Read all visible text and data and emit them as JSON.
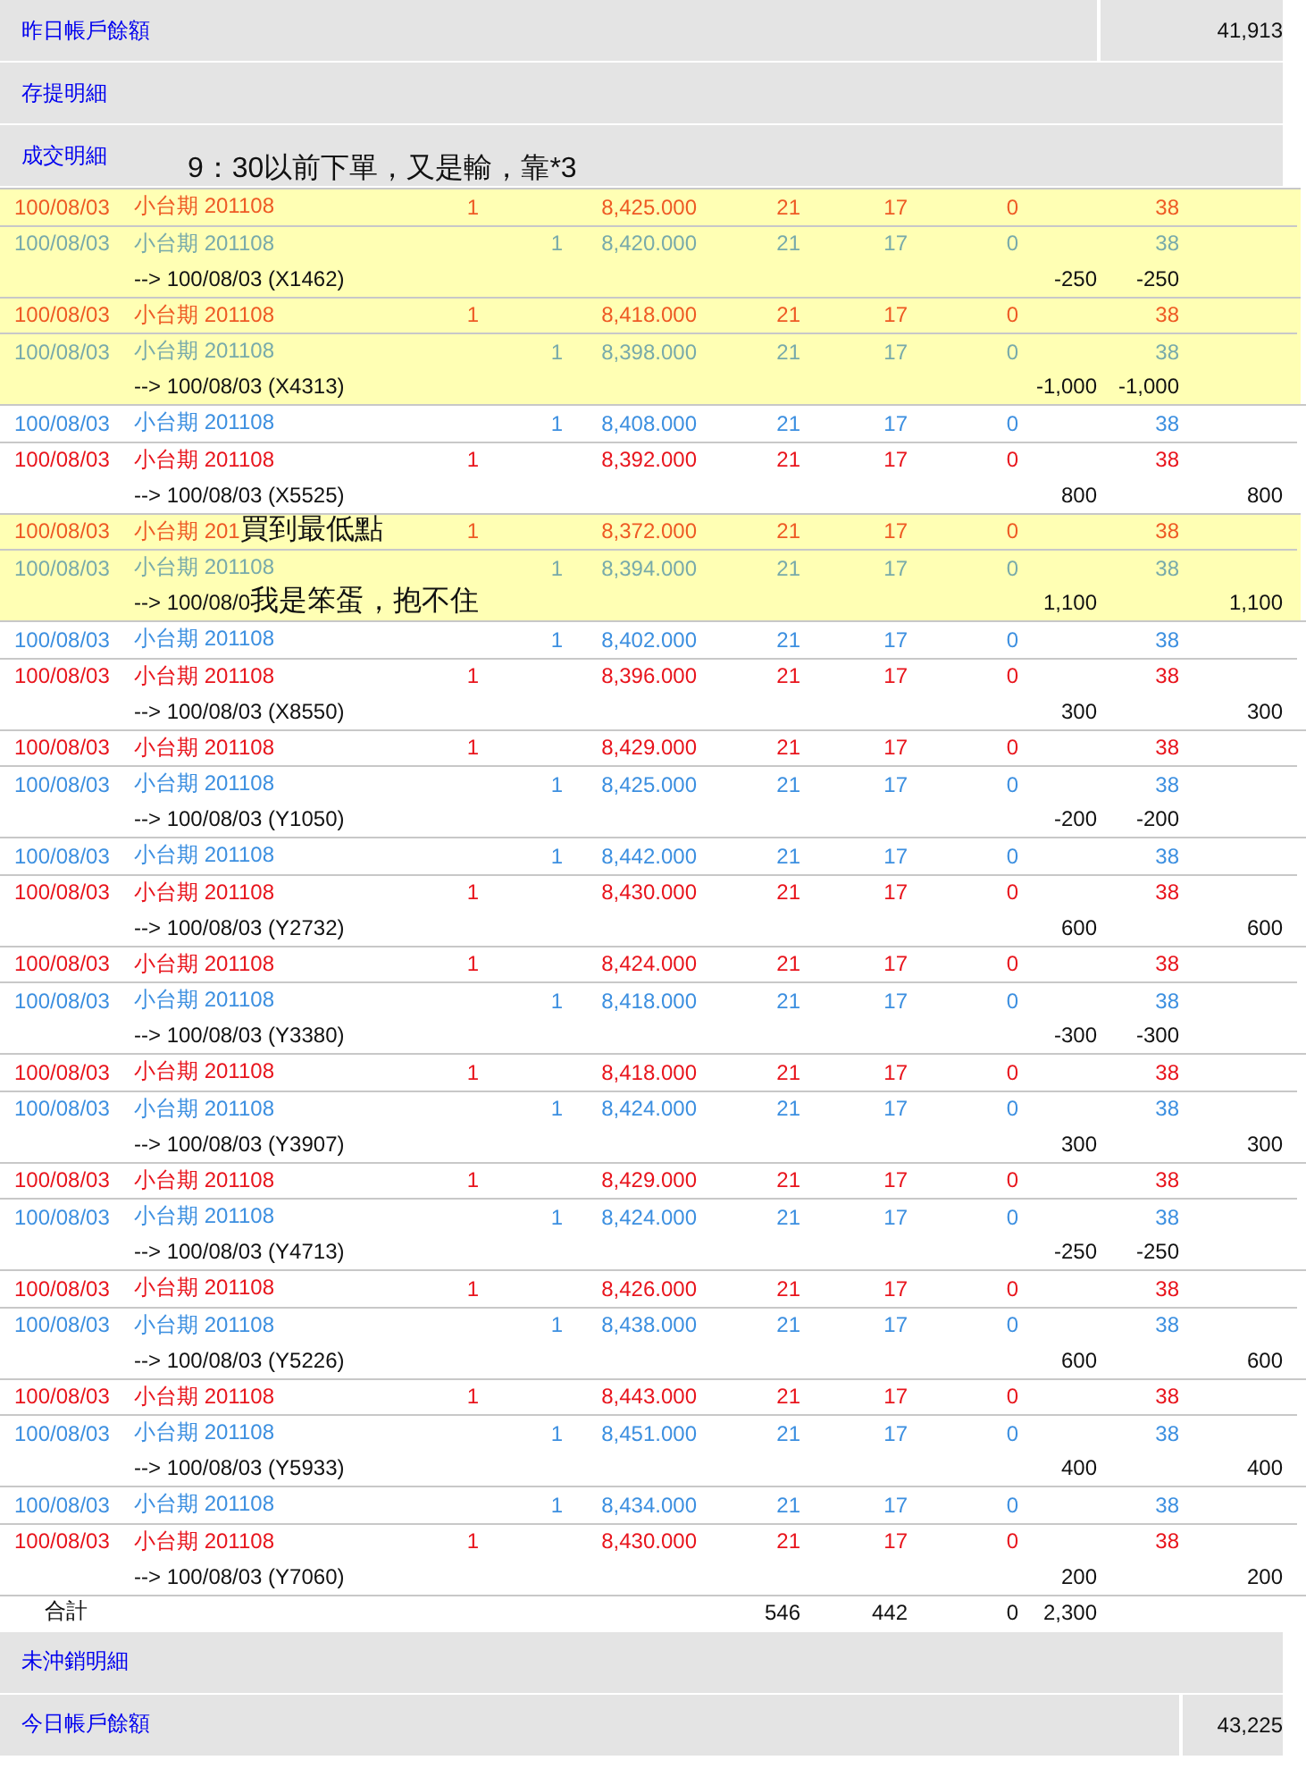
{
  "top_sections": [
    {
      "label": "昨日帳戶餘額",
      "value": "41,913"
    },
    {
      "label": "存提明細"
    },
    {
      "label": "成交明細",
      "note": "9：30以前下單，又是輸，靠*3"
    }
  ],
  "groups": [
    {
      "highlighted": true,
      "rows": [
        {
          "kind": "buy",
          "date": "100/08/03",
          "product": "小台期 201108",
          "qty": "1",
          "price": "8,425.000",
          "column_6": "21",
          "column_7": "17",
          "column_8": "0",
          "column_10": "38"
        },
        {
          "kind": "sell",
          "date": "100/08/03",
          "product": "小台期 201108",
          "qty": "1",
          "price": "8,420.000",
          "column_6": "21",
          "column_7": "17",
          "column_8": "0",
          "column_10": "38"
        }
      ],
      "close": {
        "text": "--> 100/08/03 (X1462)",
        "column_9": "-250",
        "column_10": "-250"
      }
    },
    {
      "highlighted": true,
      "rows": [
        {
          "kind": "buy",
          "date": "100/08/03",
          "product": "小台期 201108",
          "qty": "1",
          "price": "8,418.000",
          "column_6": "21",
          "column_7": "17",
          "column_8": "0",
          "column_10": "38"
        },
        {
          "kind": "sell",
          "date": "100/08/03",
          "product": "小台期 201108",
          "qty": "1",
          "price": "8,398.000",
          "column_6": "21",
          "column_7": "17",
          "column_8": "0",
          "column_10": "38"
        }
      ],
      "close": {
        "text": "--> 100/08/03 (X4313)",
        "column_9": "-1,000",
        "column_10": "-1,000"
      }
    },
    {
      "highlighted": false,
      "rows": [
        {
          "kind": "sell",
          "date": "100/08/03",
          "product": "小台期 201108",
          "qty": "1",
          "price": "8,408.000",
          "column_6": "21",
          "column_7": "17",
          "column_8": "0",
          "column_10": "38"
        },
        {
          "kind": "buy",
          "date": "100/08/03",
          "product": "小台期 201108",
          "qty": "1",
          "price": "8,392.000",
          "column_6": "21",
          "column_7": "17",
          "column_8": "0",
          "column_10": "38"
        }
      ],
      "close": {
        "text": "--> 100/08/03 (X5525)",
        "column_9": "800",
        "column_11": "800"
      }
    },
    {
      "highlighted": true,
      "rows": [
        {
          "kind": "buy",
          "date": "100/08/03",
          "product": "小台期 201",
          "note": "買到最低點",
          "qty": "1",
          "price": "8,372.000",
          "column_6": "21",
          "column_7": "17",
          "column_8": "0",
          "column_10": "38"
        },
        {
          "kind": "sell",
          "date": "100/08/03",
          "product": "小台期 201108",
          "qty": "1",
          "price": "8,394.000",
          "column_6": "21",
          "column_7": "17",
          "column_8": "0",
          "column_10": "38"
        }
      ],
      "close": {
        "text": "--> 100/08/0",
        "note": "我是笨蛋，抱不住",
        "column_9": "1,100",
        "column_11": "1,100"
      }
    },
    {
      "highlighted": false,
      "rows": [
        {
          "kind": "sell",
          "date": "100/08/03",
          "product": "小台期 201108",
          "qty": "1",
          "price": "8,402.000",
          "column_6": "21",
          "column_7": "17",
          "column_8": "0",
          "column_10": "38"
        },
        {
          "kind": "buy",
          "date": "100/08/03",
          "product": "小台期 201108",
          "qty": "1",
          "price": "8,396.000",
          "column_6": "21",
          "column_7": "17",
          "column_8": "0",
          "column_10": "38"
        }
      ],
      "close": {
        "text": "--> 100/08/03 (X8550)",
        "column_9": "300",
        "column_11": "300"
      }
    },
    {
      "highlighted": false,
      "rows": [
        {
          "kind": "buy",
          "date": "100/08/03",
          "product": "小台期 201108",
          "qty": "1",
          "price": "8,429.000",
          "column_6": "21",
          "column_7": "17",
          "column_8": "0",
          "column_10": "38"
        },
        {
          "kind": "sell",
          "date": "100/08/03",
          "product": "小台期 201108",
          "qty": "1",
          "price": "8,425.000",
          "column_6": "21",
          "column_7": "17",
          "column_8": "0",
          "column_10": "38"
        }
      ],
      "close": {
        "text": "--> 100/08/03 (Y1050)",
        "column_9": "-200",
        "column_10": "-200"
      }
    },
    {
      "highlighted": false,
      "rows": [
        {
          "kind": "sell",
          "date": "100/08/03",
          "product": "小台期 201108",
          "qty": "1",
          "price": "8,442.000",
          "column_6": "21",
          "column_7": "17",
          "column_8": "0",
          "column_10": "38"
        },
        {
          "kind": "buy",
          "date": "100/08/03",
          "product": "小台期 201108",
          "qty": "1",
          "price": "8,430.000",
          "column_6": "21",
          "column_7": "17",
          "column_8": "0",
          "column_10": "38"
        }
      ],
      "close": {
        "text": "--> 100/08/03 (Y2732)",
        "column_9": "600",
        "column_11": "600"
      }
    },
    {
      "highlighted": false,
      "rows": [
        {
          "kind": "buy",
          "date": "100/08/03",
          "product": "小台期 201108",
          "qty": "1",
          "price": "8,424.000",
          "column_6": "21",
          "column_7": "17",
          "column_8": "0",
          "column_10": "38"
        },
        {
          "kind": "sell",
          "date": "100/08/03",
          "product": "小台期 201108",
          "qty": "1",
          "price": "8,418.000",
          "column_6": "21",
          "column_7": "17",
          "column_8": "0",
          "column_10": "38"
        }
      ],
      "close": {
        "text": "--> 100/08/03 (Y3380)",
        "column_9": "-300",
        "column_10": "-300"
      }
    },
    {
      "highlighted": false,
      "rows": [
        {
          "kind": "buy",
          "date": "100/08/03",
          "product": "小台期 201108",
          "qty": "1",
          "price": "8,418.000",
          "column_6": "21",
          "column_7": "17",
          "column_8": "0",
          "column_10": "38"
        },
        {
          "kind": "sell",
          "date": "100/08/03",
          "product": "小台期 201108",
          "qty": "1",
          "price": "8,424.000",
          "column_6": "21",
          "column_7": "17",
          "column_8": "0",
          "column_10": "38"
        }
      ],
      "close": {
        "text": "--> 100/08/03 (Y3907)",
        "column_9": "300",
        "column_11": "300"
      }
    },
    {
      "highlighted": false,
      "rows": [
        {
          "kind": "buy",
          "date": "100/08/03",
          "product": "小台期 201108",
          "qty": "1",
          "price": "8,429.000",
          "column_6": "21",
          "column_7": "17",
          "column_8": "0",
          "column_10": "38"
        },
        {
          "kind": "sell",
          "date": "100/08/03",
          "product": "小台期 201108",
          "qty": "1",
          "price": "8,424.000",
          "column_6": "21",
          "column_7": "17",
          "column_8": "0",
          "column_10": "38"
        }
      ],
      "close": {
        "text": "--> 100/08/03 (Y4713)",
        "column_9": "-250",
        "column_10": "-250"
      }
    },
    {
      "highlighted": false,
      "rows": [
        {
          "kind": "buy",
          "date": "100/08/03",
          "product": "小台期 201108",
          "qty": "1",
          "price": "8,426.000",
          "column_6": "21",
          "column_7": "17",
          "column_8": "0",
          "column_10": "38"
        },
        {
          "kind": "sell",
          "date": "100/08/03",
          "product": "小台期 201108",
          "qty": "1",
          "price": "8,438.000",
          "column_6": "21",
          "column_7": "17",
          "column_8": "0",
          "column_10": "38"
        }
      ],
      "close": {
        "text": "--> 100/08/03 (Y5226)",
        "column_9": "600",
        "column_11": "600"
      }
    },
    {
      "highlighted": false,
      "rows": [
        {
          "kind": "buy",
          "date": "100/08/03",
          "product": "小台期 201108",
          "qty": "1",
          "price": "8,443.000",
          "column_6": "21",
          "column_7": "17",
          "column_8": "0",
          "column_10": "38"
        },
        {
          "kind": "sell",
          "date": "100/08/03",
          "product": "小台期 201108",
          "qty": "1",
          "price": "8,451.000",
          "column_6": "21",
          "column_7": "17",
          "column_8": "0",
          "column_10": "38"
        }
      ],
      "close": {
        "text": "--> 100/08/03 (Y5933)",
        "column_9": "400",
        "column_11": "400"
      }
    },
    {
      "highlighted": false,
      "rows": [
        {
          "kind": "sell",
          "date": "100/08/03",
          "product": "小台期 201108",
          "qty": "1",
          "price": "8,434.000",
          "column_6": "21",
          "column_7": "17",
          "column_8": "0",
          "column_10": "38"
        },
        {
          "kind": "buy",
          "date": "100/08/03",
          "product": "小台期 201108",
          "qty": "1",
          "price": "8,430.000",
          "column_6": "21",
          "column_7": "17",
          "column_8": "0",
          "column_10": "38"
        }
      ],
      "close": {
        "text": "--> 100/08/03 (Y7060)",
        "column_9": "200",
        "column_11": "200"
      }
    }
  ],
  "total": {
    "label": "合計",
    "column_6": "546",
    "column_7": "442",
    "column_8": "0",
    "column_9": "2,300"
  },
  "bottom_sections": [
    {
      "label": "未沖銷明細"
    },
    {
      "label": "今日帳戶餘額",
      "value": "43,225"
    }
  ]
}
